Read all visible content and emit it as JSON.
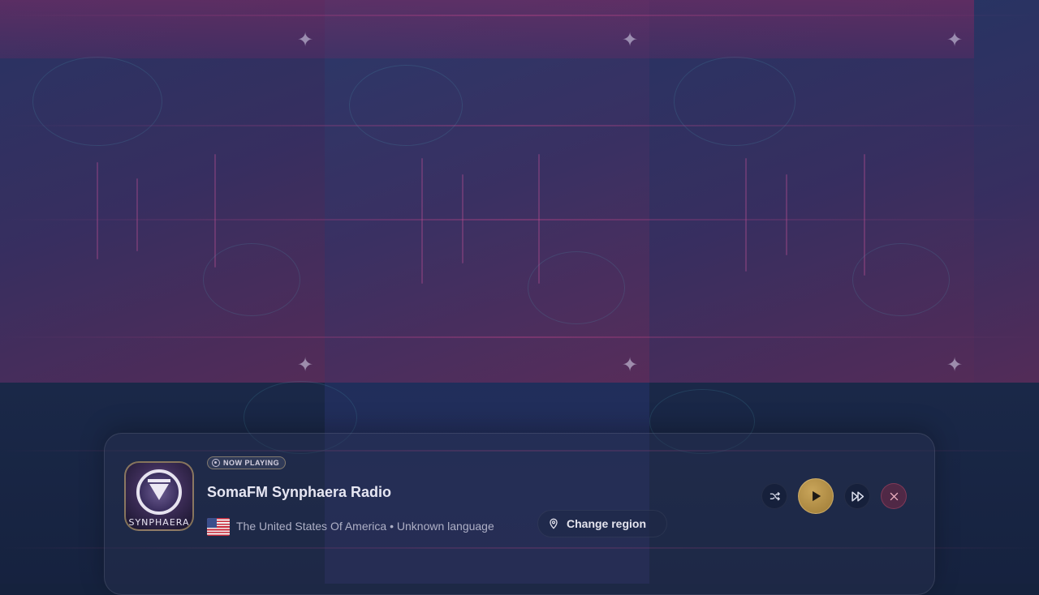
{
  "now_playing": {
    "badge_label": "NOW PLAYING",
    "station_name": "SomaFM Synphaera Radio",
    "logo_text": "SYNPHAERA",
    "country": "The United States Of America",
    "separator": "•",
    "language": "Unknown language",
    "flag_icon": "us-flag-icon"
  },
  "region": {
    "button_label": "Change region",
    "icon": "location-pin-icon"
  },
  "controls": {
    "shuffle_icon": "shuffle-icon",
    "play_icon": "play-icon",
    "forward_icon": "fast-forward-icon",
    "close_icon": "close-icon"
  },
  "colors": {
    "play_accent": "#b8954a",
    "close_accent": "#d86a8a",
    "background": "#1b2a4c"
  }
}
